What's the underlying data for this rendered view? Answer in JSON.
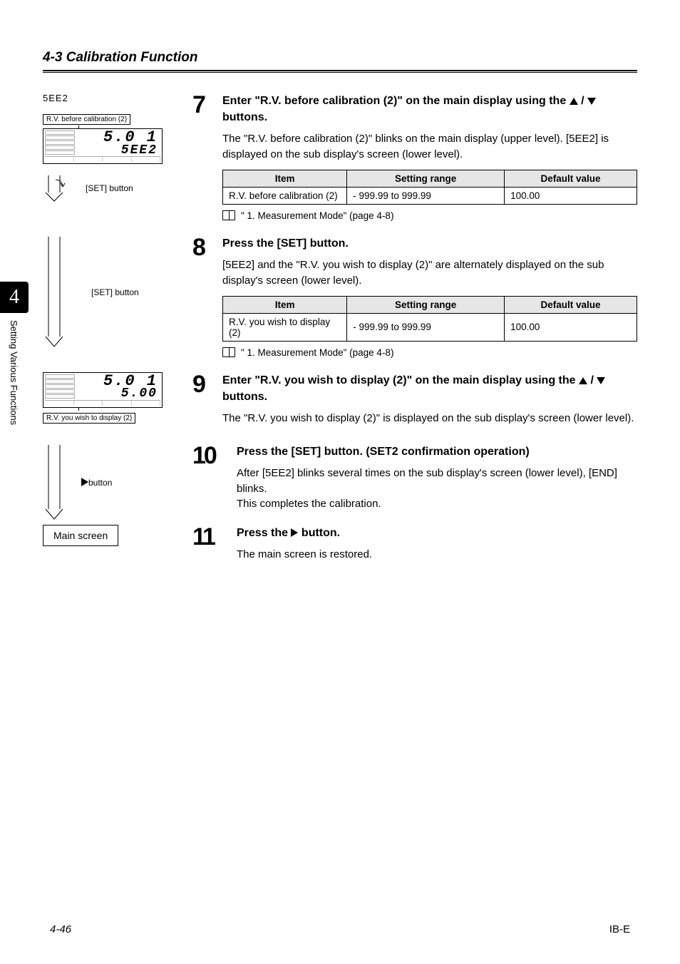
{
  "header": {
    "section_title": "4-3  Calibration Function"
  },
  "side": {
    "number": "4",
    "label": "Setting Various Functions"
  },
  "step7": {
    "seg_code": "5EE2",
    "callout_device": "R.V. before calibration (2)",
    "device_top_reading": "5.0 1",
    "device_bottom_reading": "5EE2",
    "btn_label": "[SET] button",
    "head_a": "Enter \"R.V. before calibration (2)\" on the main display using the ",
    "head_b": " buttons.",
    "body": "The \"R.V. before calibration (2)\" blinks on the main display (upper level). [5EE2] is displayed on the sub display's screen (lower level).",
    "table": {
      "h1": "Item",
      "h2": "Setting range",
      "h3": "Default value",
      "c1": "R.V. before calibration (2)",
      "c2": "- 999.99 to 999.99",
      "c3": "100.00"
    },
    "ref": "\" 1. Measurement Mode\" (page 4-8)"
  },
  "step8": {
    "btn_label": "[SET] button",
    "head": "Press the [SET] button.",
    "body": "[5EE2] and the \"R.V. you wish to display (2)\" are alternately displayed on the sub display's screen (lower level).",
    "table": {
      "h1": "Item",
      "h2": "Setting range",
      "h3": "Default value",
      "c1": "R.V. you wish to display (2)",
      "c2": "- 999.99 to 999.99",
      "c3": "100.00"
    },
    "ref": "\" 1. Measurement Mode\" (page 4-8)"
  },
  "step9": {
    "device_top_reading": "5.0 1",
    "device_bottom_reading": "5.00",
    "callout_device": "R.V. you wish to display (2)",
    "head_a": "Enter \"R.V. you wish to display (2)\" on the main display using the ",
    "head_b": " buttons.",
    "body": "The \"R.V. you wish to display (2)\" is displayed on the sub display's screen (lower level)."
  },
  "step10": {
    "btn_label": "button",
    "head": "Press the [SET] button. (SET2 confirmation operation)",
    "body": "After [5EE2] blinks several times on the sub display's screen (lower level), [END] blinks.\nThis completes the calibration."
  },
  "step11": {
    "main_screen": "Main screen",
    "head_a": "Press the ",
    "head_b": " button.",
    "body": "The main screen is restored."
  },
  "footer": {
    "left": "4-46",
    "right": "IB-E"
  }
}
